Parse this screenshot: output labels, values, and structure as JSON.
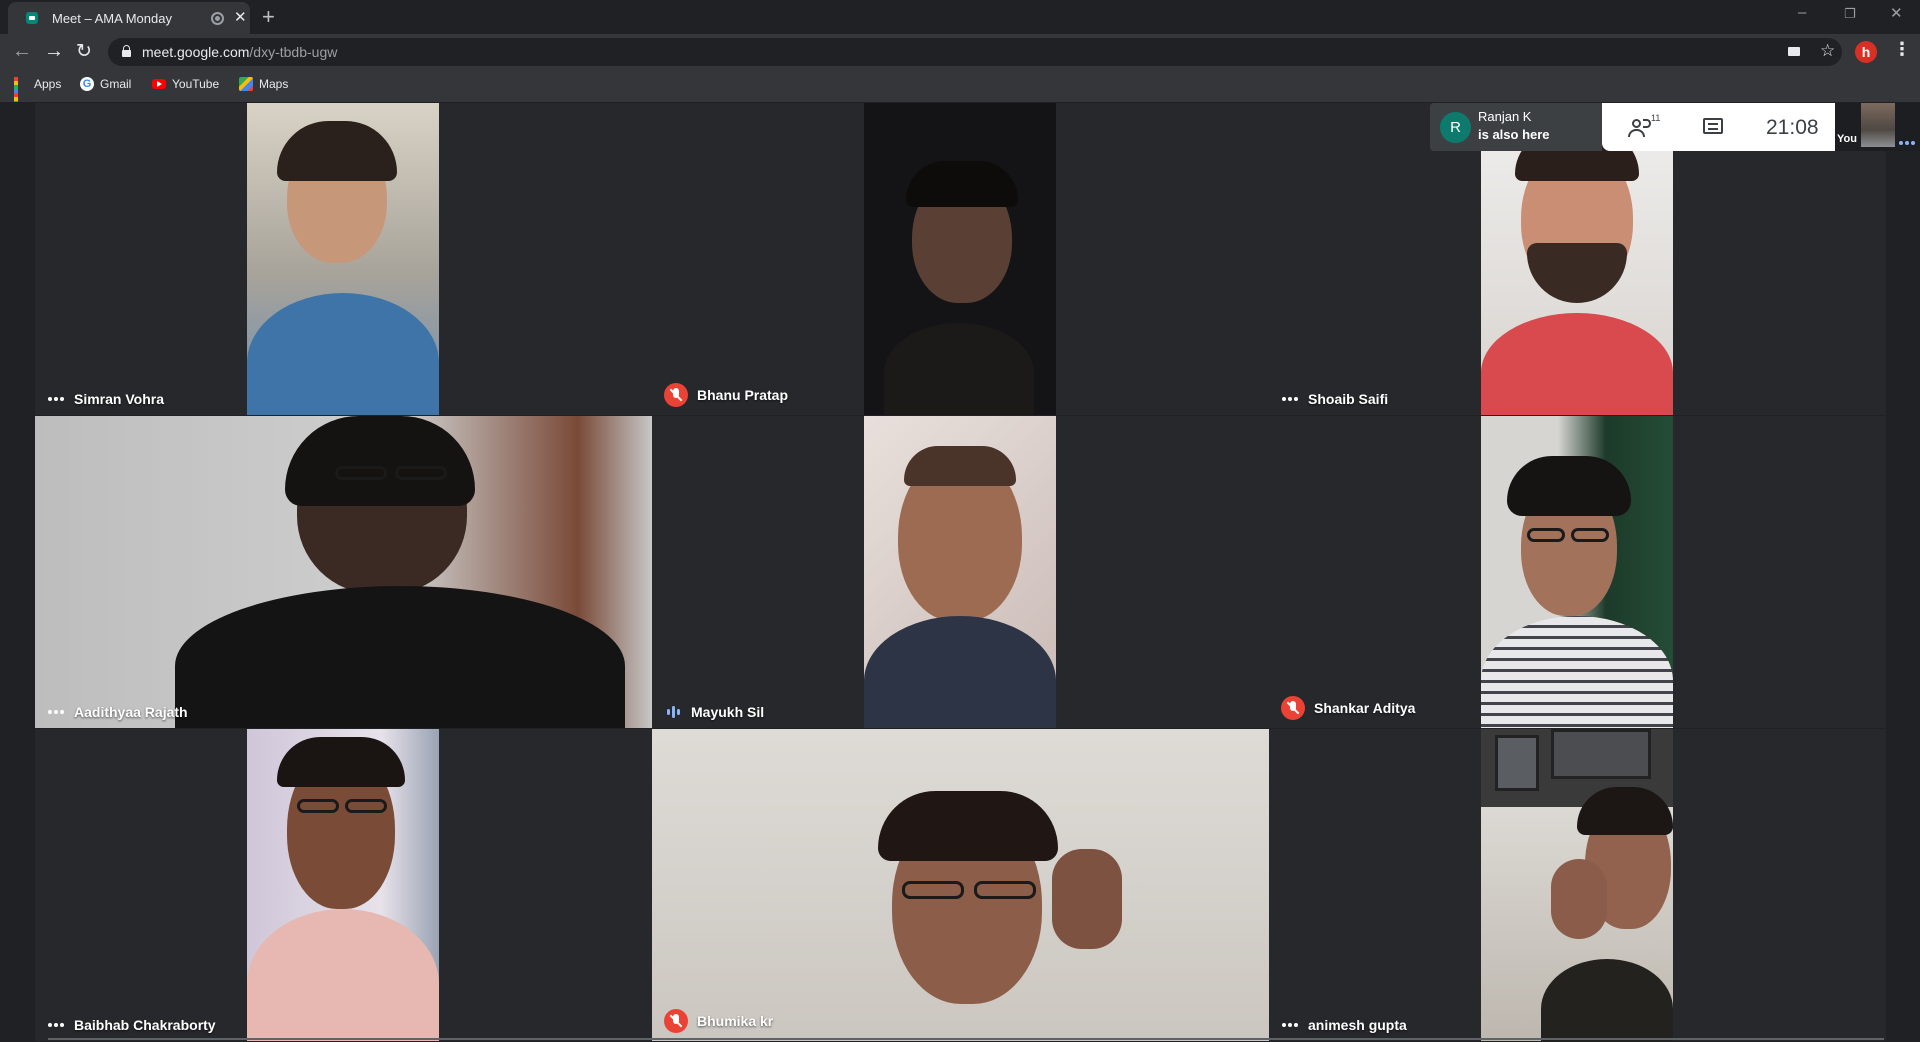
{
  "browser": {
    "tab_title": "Meet – AMA Monday",
    "new_tab_label": "+",
    "url_host": "meet.google.com",
    "url_path": "/dxy-tbdb-ugw",
    "profile_initial": "h",
    "window_controls": [
      "–",
      "❐",
      "✕"
    ]
  },
  "bookmarks": [
    {
      "label": "Apps",
      "icon": "apps-grid-icon"
    },
    {
      "label": "Gmail",
      "icon": "google-icon"
    },
    {
      "label": "YouTube",
      "icon": "youtube-icon"
    },
    {
      "label": "Maps",
      "icon": "maps-icon"
    }
  ],
  "meeting": {
    "notification": {
      "avatar_initial": "R",
      "name": "Ranjan K",
      "message": "is also here"
    },
    "participant_count": "11",
    "time": "21:08",
    "self_label": "You"
  },
  "participants": [
    {
      "name": "Simran Vohra",
      "status": "more"
    },
    {
      "name": "Bhanu Pratap",
      "status": "muted"
    },
    {
      "name": "Shoaib Saifi",
      "status": "more"
    },
    {
      "name": "Aadithyaa Rajath",
      "status": "more"
    },
    {
      "name": "Mayukh Sil",
      "status": "speaking"
    },
    {
      "name": "Shankar Aditya",
      "status": "muted"
    },
    {
      "name": "Baibhab Chakraborty",
      "status": "more"
    },
    {
      "name": "Bhumika kr",
      "status": "muted"
    },
    {
      "name": "animesh gupta",
      "status": "more"
    }
  ],
  "colors": {
    "background": "#202124",
    "tile": "#27282c",
    "muted_red": "#ea4335",
    "speaking_blue": "#8ab4f8",
    "notification_avatar": "#0e7a6e"
  }
}
